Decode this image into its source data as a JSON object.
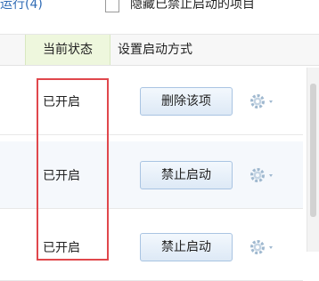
{
  "topbar": {
    "link_text": "运行(4)",
    "hide_disabled_label": "隐藏已禁止启动的项目"
  },
  "table": {
    "columns": [
      "当前状态",
      "设置启动方式"
    ],
    "rows": [
      {
        "status": "已开启",
        "action": "删除该项"
      },
      {
        "status": "已开启",
        "action": "禁止启动"
      },
      {
        "status": "已开启",
        "action": "禁止启动"
      }
    ]
  },
  "colors": {
    "link": "#2f6bb5",
    "header_highlight": "#eef7dd",
    "highlight_box": "#e0474c",
    "button_border": "#a9c4e2",
    "gear": "#9fb8cf"
  },
  "icons": {
    "row_menu": "gear-icon",
    "dropdown": "chevron-down-icon"
  }
}
